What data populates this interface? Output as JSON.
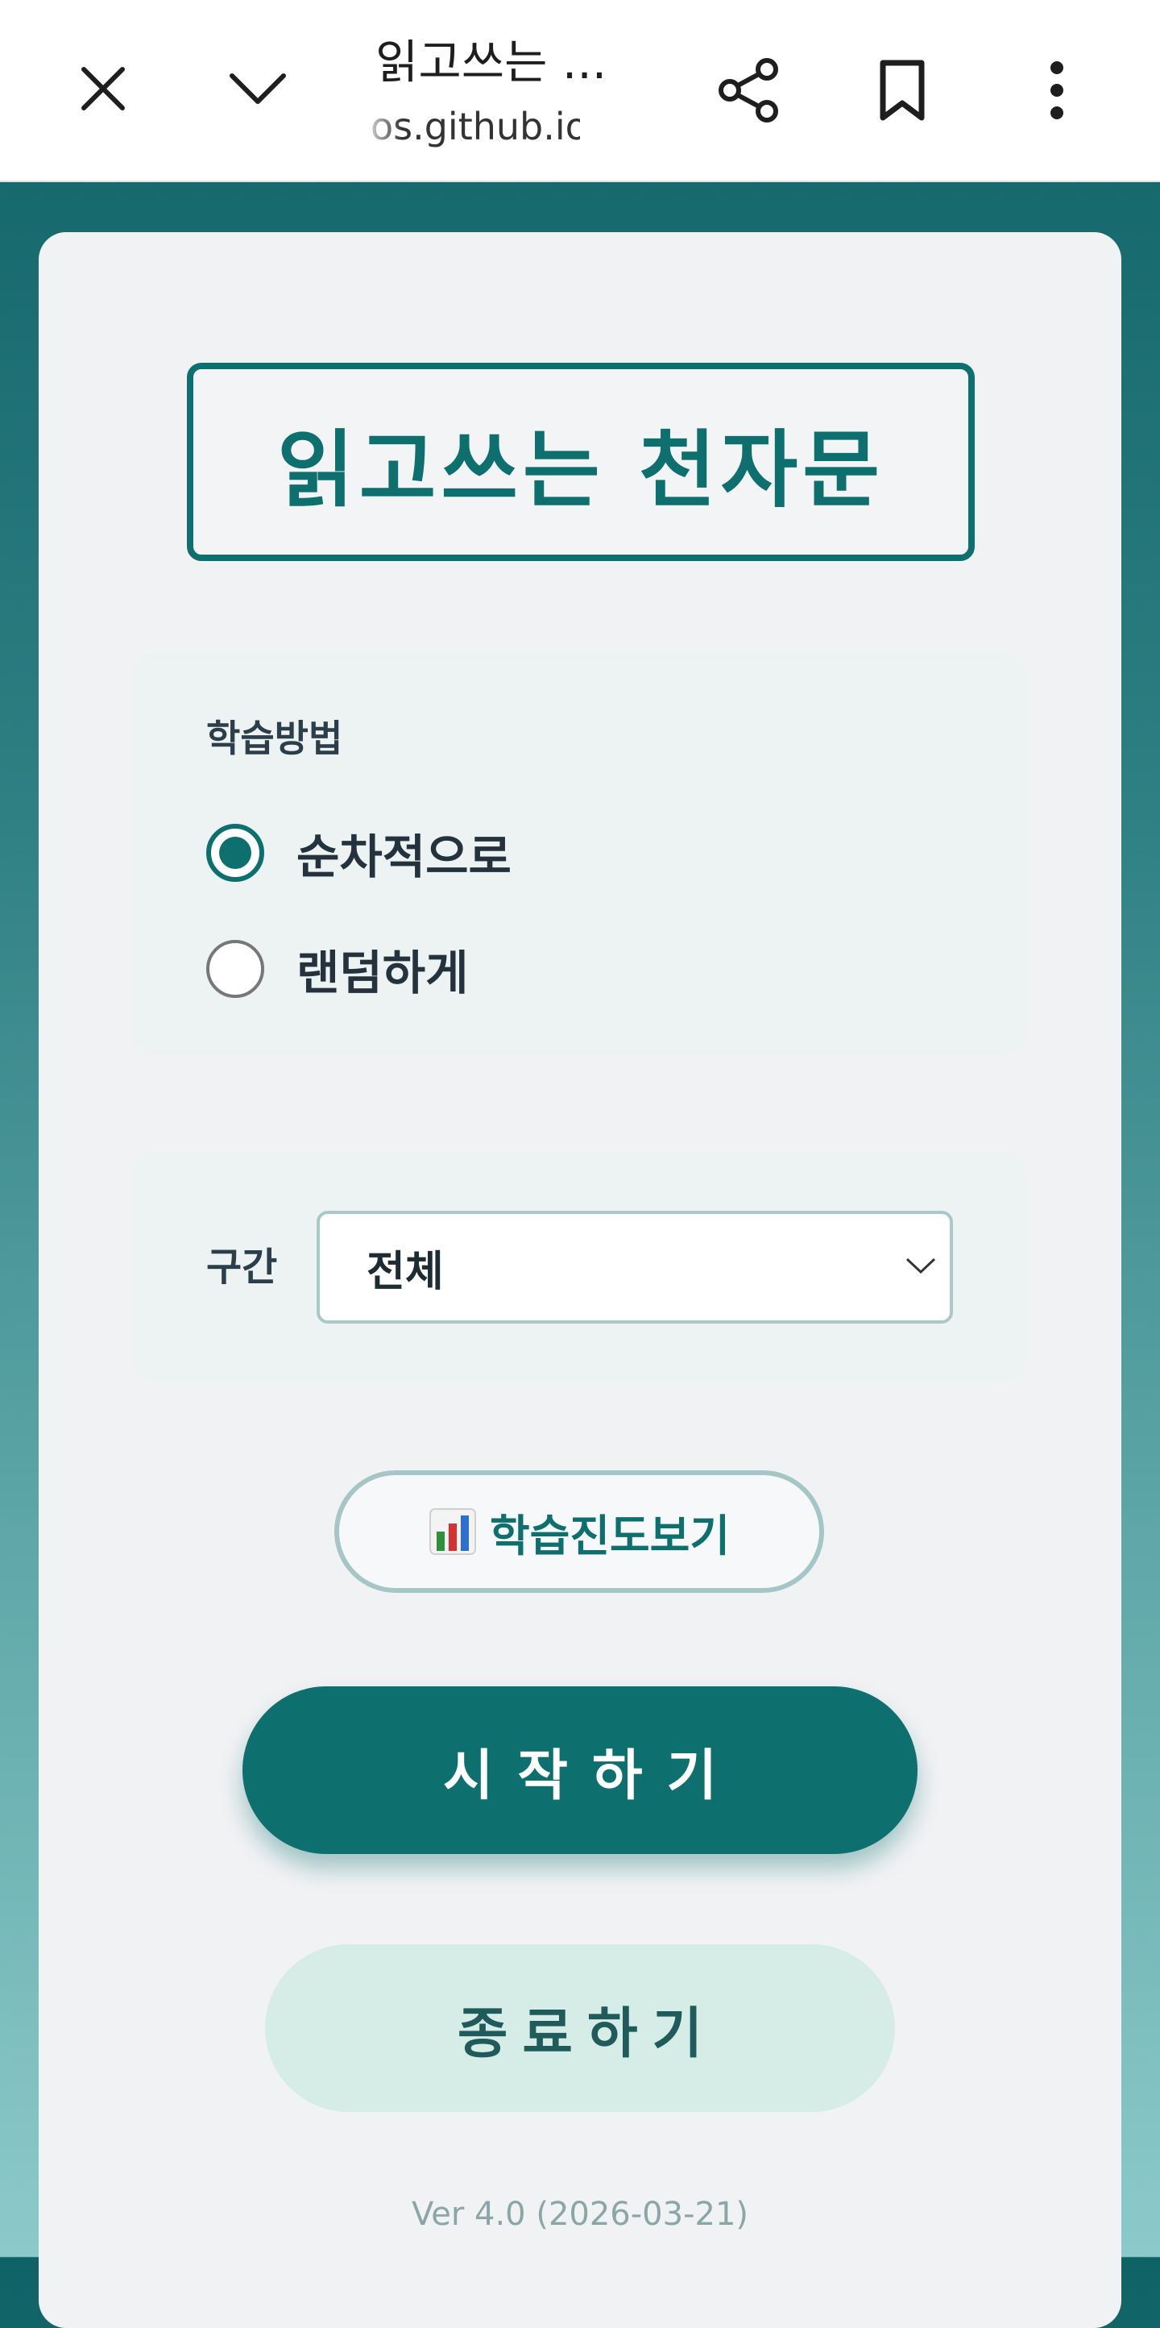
{
  "browser": {
    "page_title": "읽고쓰는 ...",
    "url": "os.github.io",
    "icons": [
      "close-icon",
      "chevron-down-icon",
      "share-icon",
      "bookmark-icon",
      "more-vert-icon"
    ]
  },
  "app": {
    "title": "읽고쓰는 천자문",
    "method_label": "학습방법",
    "methods": [
      {
        "label": "순차적으로",
        "selected": true
      },
      {
        "label": "랜덤하게",
        "selected": false
      }
    ],
    "range_label": "구간",
    "range_value": "전체",
    "progress_icon": "📊",
    "progress_label": "학습진도보기",
    "start_label": "시작하기",
    "end_label": "종료하기",
    "version": "Ver 4.0 (2026-03-21)"
  },
  "colors": {
    "primary": "#0e6f6f",
    "secondary_button": "#d6ece7",
    "card_bg": "#f1f2f4"
  }
}
